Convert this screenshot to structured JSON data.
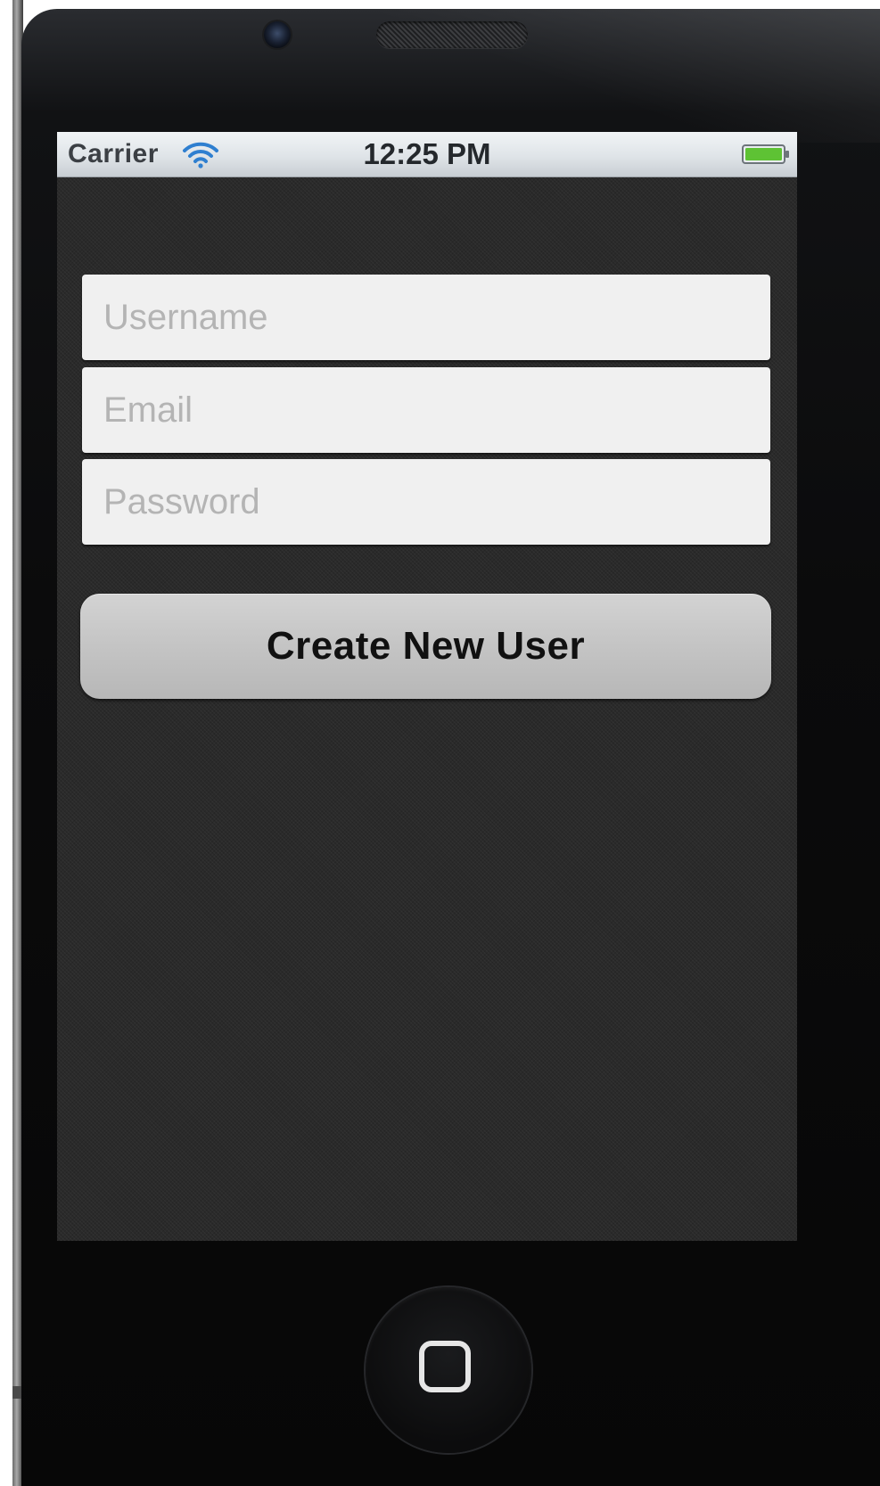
{
  "status_bar": {
    "carrier": "Carrier",
    "time": "12:25 PM",
    "wifi_icon": "wifi-icon",
    "battery_icon": "battery-icon",
    "battery_color": "#5ec234"
  },
  "form": {
    "username": {
      "placeholder": "Username",
      "value": ""
    },
    "email": {
      "placeholder": "Email",
      "value": ""
    },
    "password": {
      "placeholder": "Password",
      "value": ""
    }
  },
  "actions": {
    "create_label": "Create New User"
  },
  "device": {
    "home_icon": "home-button-icon",
    "camera_icon": "front-camera-icon",
    "speaker_icon": "earpiece-speaker-icon"
  }
}
